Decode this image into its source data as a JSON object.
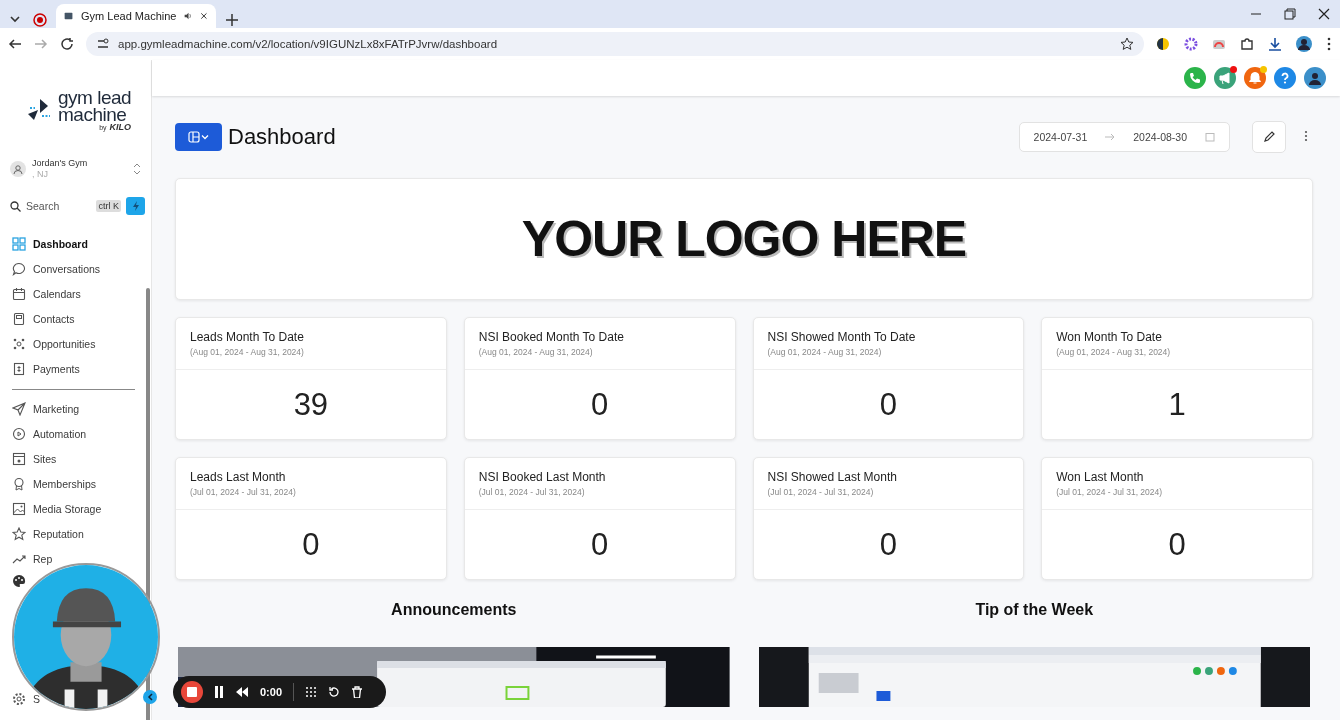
{
  "browser": {
    "tab_title": "Gym Lead Machine",
    "url": "app.gymleadmachine.com/v2/location/v9IGUNzLx8xFATrPJvrw/dashboard"
  },
  "sidebar": {
    "logo": {
      "line_1": "gym lead",
      "line_2": "machine",
      "by": "by",
      "maker": "KILO"
    },
    "account": {
      "name": "Jordan's Gym",
      "location": ", NJ"
    },
    "search": {
      "placeholder": "Search",
      "shortcut": "ctrl K"
    },
    "primary_items": [
      {
        "label": "Dashboard",
        "selected": true
      },
      {
        "label": "Conversations",
        "selected": false
      },
      {
        "label": "Calendars",
        "selected": false
      },
      {
        "label": "Contacts",
        "selected": false
      },
      {
        "label": "Opportunities",
        "selected": false
      },
      {
        "label": "Payments",
        "selected": false
      }
    ],
    "secondary_items": [
      {
        "label": "Marketing",
        "selected": false
      },
      {
        "label": "Automation",
        "selected": false
      },
      {
        "label": "Sites",
        "selected": false
      },
      {
        "label": "Memberships",
        "selected": false
      },
      {
        "label": "Media Storage",
        "selected": false
      },
      {
        "label": "Reputation",
        "selected": false
      },
      {
        "label": "Rep",
        "selected": false
      }
    ],
    "settings_item": {
      "label": "S",
      "selected": false
    }
  },
  "top_actions": [
    {
      "kind": "phone",
      "badge": false
    },
    {
      "kind": "megaphone",
      "badge": true
    },
    {
      "kind": "bell",
      "badge": true
    },
    {
      "kind": "help",
      "badge": false
    },
    {
      "kind": "avatar",
      "badge": false
    }
  ],
  "header": {
    "title": "Dashboard",
    "date_start": "2024-07-31",
    "date_end": "2024-08-30"
  },
  "logo_banner": "YOUR LOGO HERE",
  "stats": [
    {
      "title": "Leads Month To Date",
      "range": "(Aug 01, 2024 - Aug 31, 2024)",
      "value": "39"
    },
    {
      "title": "NSI Booked Month To Date",
      "range": "(Aug 01, 2024 - Aug 31, 2024)",
      "value": "0"
    },
    {
      "title": "NSI Showed Month To Date",
      "range": "(Aug 01, 2024 - Aug 31, 2024)",
      "value": "0"
    },
    {
      "title": "Won Month To Date",
      "range": "(Aug 01, 2024 - Aug 31, 2024)",
      "value": "1"
    },
    {
      "title": "Leads Last Month",
      "range": "(Jul 01, 2024 - Jul 31, 2024)",
      "value": "0"
    },
    {
      "title": "NSI Booked Last Month",
      "range": "(Jul 01, 2024 - Jul 31, 2024)",
      "value": "0"
    },
    {
      "title": "NSI Showed Last Month",
      "range": "(Jul 01, 2024 - Jul 31, 2024)",
      "value": "0"
    },
    {
      "title": "Won Last Month",
      "range": "(Jul 01, 2024 - Jul 31, 2024)",
      "value": "0"
    }
  ],
  "sections": [
    {
      "title": "Announcements"
    },
    {
      "title": "Tip of the Week"
    }
  ],
  "recorder": {
    "time": "0:00"
  }
}
